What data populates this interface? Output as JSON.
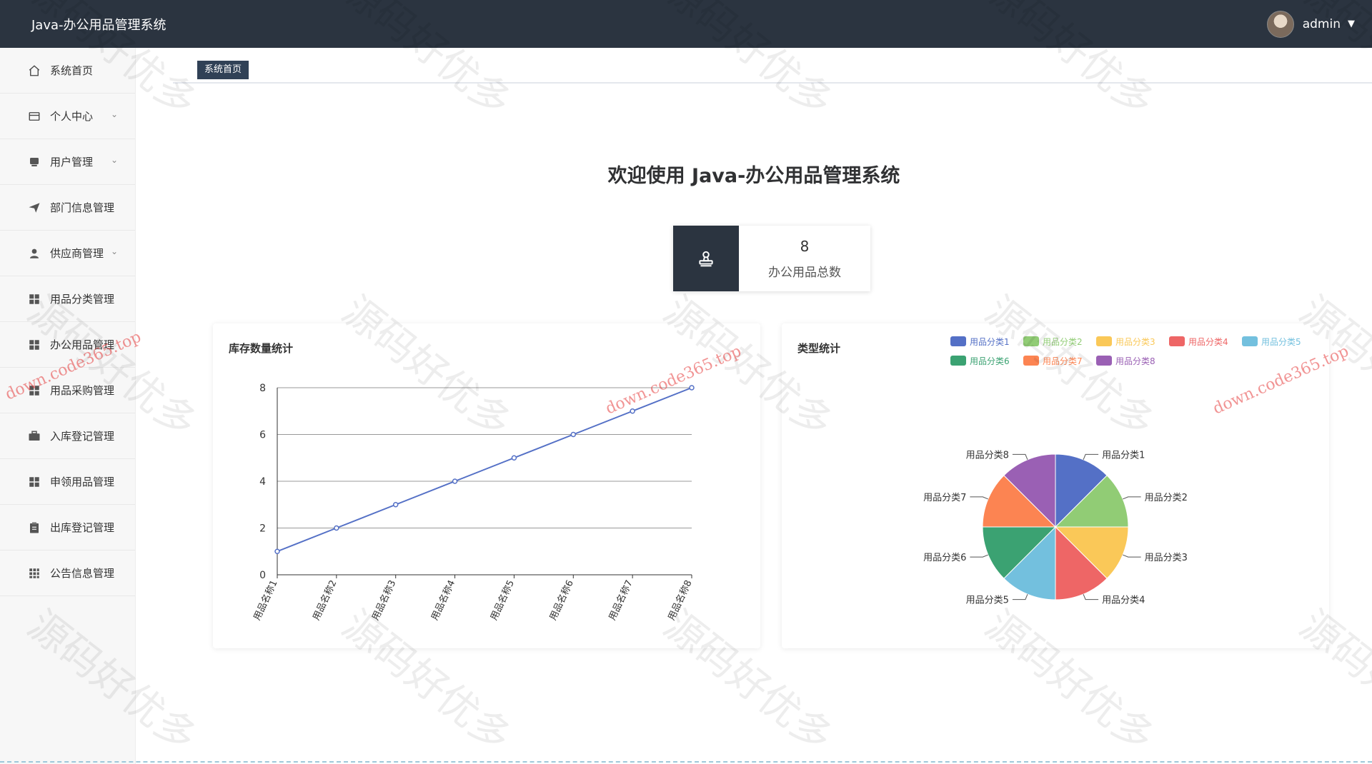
{
  "header": {
    "app_title": "Java-办公用品管理系统",
    "username": "admin"
  },
  "sidebar": {
    "items": [
      {
        "label": "系统首页",
        "icon": "home-icon",
        "has_submenu": false
      },
      {
        "label": "个人中心",
        "icon": "wallet-icon",
        "has_submenu": true
      },
      {
        "label": "用户管理",
        "icon": "user-card-icon",
        "has_submenu": true
      },
      {
        "label": "部门信息管理",
        "icon": "paper-plane-icon",
        "has_submenu": false
      },
      {
        "label": "供应商管理",
        "icon": "user-icon",
        "has_submenu": true
      },
      {
        "label": "用品分类管理",
        "icon": "grid-icon",
        "has_submenu": false
      },
      {
        "label": "办公用品管理",
        "icon": "grid-icon",
        "has_submenu": false
      },
      {
        "label": "用品采购管理",
        "icon": "grid-icon",
        "has_submenu": false
      },
      {
        "label": "入库登记管理",
        "icon": "briefcase-icon",
        "has_submenu": false
      },
      {
        "label": "申领用品管理",
        "icon": "grid-icon",
        "has_submenu": false
      },
      {
        "label": "出库登记管理",
        "icon": "clipboard-icon",
        "has_submenu": false
      },
      {
        "label": "公告信息管理",
        "icon": "apps-icon",
        "has_submenu": false
      }
    ]
  },
  "tabs": {
    "active_label": "系统首页"
  },
  "main": {
    "welcome": "欢迎使用 Java-办公用品管理系统",
    "stat": {
      "value": "8",
      "label": "办公用品总数",
      "icon": "stamp-icon"
    }
  },
  "watermark": {
    "text": "源码好优多",
    "small_text": "gzh源码好优多",
    "link": "down.code365.top"
  },
  "colors": {
    "header_bg": "#2b3440",
    "line_color": "#5470c6",
    "pie_colors": [
      "#5470c6",
      "#91cc75",
      "#fac858",
      "#ee6666",
      "#73c0de",
      "#3ba272",
      "#fc8452",
      "#9a60b4"
    ]
  },
  "chart_data": [
    {
      "type": "line",
      "title": "库存数量统计",
      "categories": [
        "用品名称1",
        "用品名称2",
        "用品名称3",
        "用品名称4",
        "用品名称5",
        "用品名称6",
        "用品名称7",
        "用品名称8"
      ],
      "values": [
        1,
        2,
        3,
        4,
        5,
        6,
        7,
        8
      ],
      "ylim": [
        0,
        8
      ],
      "yticks": [
        0,
        2,
        4,
        6,
        8
      ],
      "grid": true
    },
    {
      "type": "pie",
      "title": "类型统计",
      "labels": [
        "用品分类1",
        "用品分类2",
        "用品分类3",
        "用品分类4",
        "用品分类5",
        "用品分类6",
        "用品分类7",
        "用品分类8"
      ],
      "values": [
        1,
        1,
        1,
        1,
        1,
        1,
        1,
        1
      ],
      "legend": "top-right"
    }
  ]
}
